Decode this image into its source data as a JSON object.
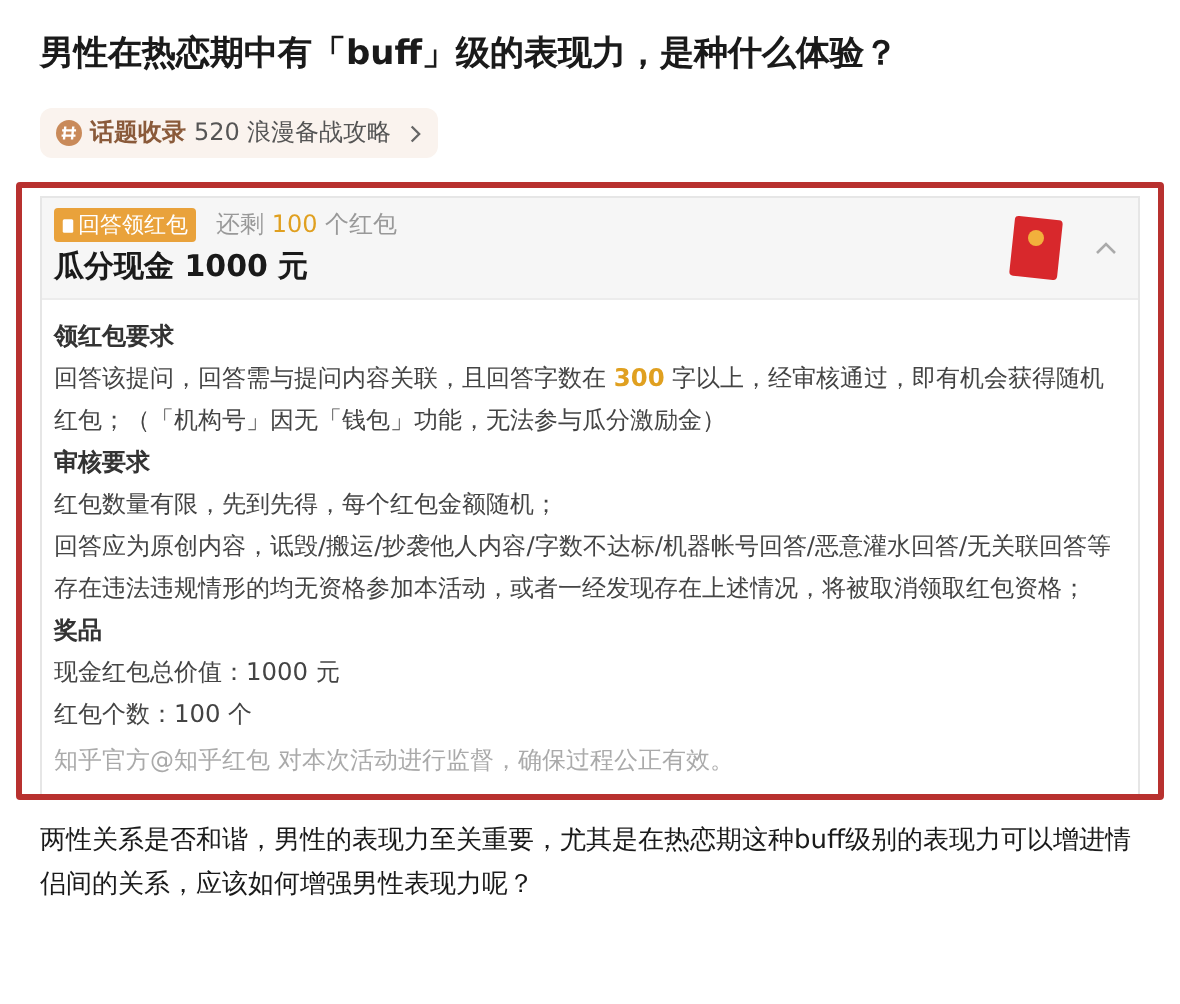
{
  "question": {
    "title": "男性在热恋期中有「buff」级的表现力，是种什么体验？"
  },
  "topic_chip": {
    "label": "话题收录",
    "topic": "520 浪漫备战攻略"
  },
  "red_packet_card": {
    "badge": "回答领红包",
    "remaining": [
      {
        "text": "还剩 ",
        "highlight": false
      },
      {
        "text": "100",
        "highlight": true
      },
      {
        "text": " 个红包",
        "highlight": false
      }
    ],
    "headline": "瓜分现金 1000 元",
    "expanded": true,
    "sections": [
      {
        "heading": "领红包要求",
        "paragraphs": [
          [
            {
              "text": "回答该提问，回答需与提问内容关联，且回答字数在 ",
              "highlight": false
            },
            {
              "text": "300",
              "highlight": true
            },
            {
              "text": " 字以上，经审核通过，即有机会获得随机红包；（「机构号」因无「钱包」功能，无法参与瓜分激励金）",
              "highlight": false
            }
          ]
        ]
      },
      {
        "heading": "审核要求",
        "paragraphs": [
          [
            {
              "text": "红包数量有限，先到先得，每个红包金额随机；",
              "highlight": false
            }
          ],
          [
            {
              "text": "回答应为原创内容，诋毁/搬运/抄袭他人内容/字数不达标/机器帐号回答/恶意灌水回答/无关联回答等存在违法违规情形的均无资格参加本活动，或者一经发现存在上述情况，将被取消领取红包资格；",
              "highlight": false
            }
          ]
        ]
      },
      {
        "heading": "奖品",
        "paragraphs": [
          [
            {
              "text": "现金红包总价值：1000 元",
              "highlight": false
            }
          ],
          [
            {
              "text": "红包个数：100 个",
              "highlight": false
            }
          ]
        ]
      }
    ],
    "footnote": "知乎官方@知乎红包 对本次活动进行监督，确保过程公正有效。"
  },
  "description": "两性关系是否和谐，男性的表现力至关重要，尤其是在热恋期这种buff级别的表现力可以增进情侣间的关系，应该如何增强男性表现力呢？"
}
